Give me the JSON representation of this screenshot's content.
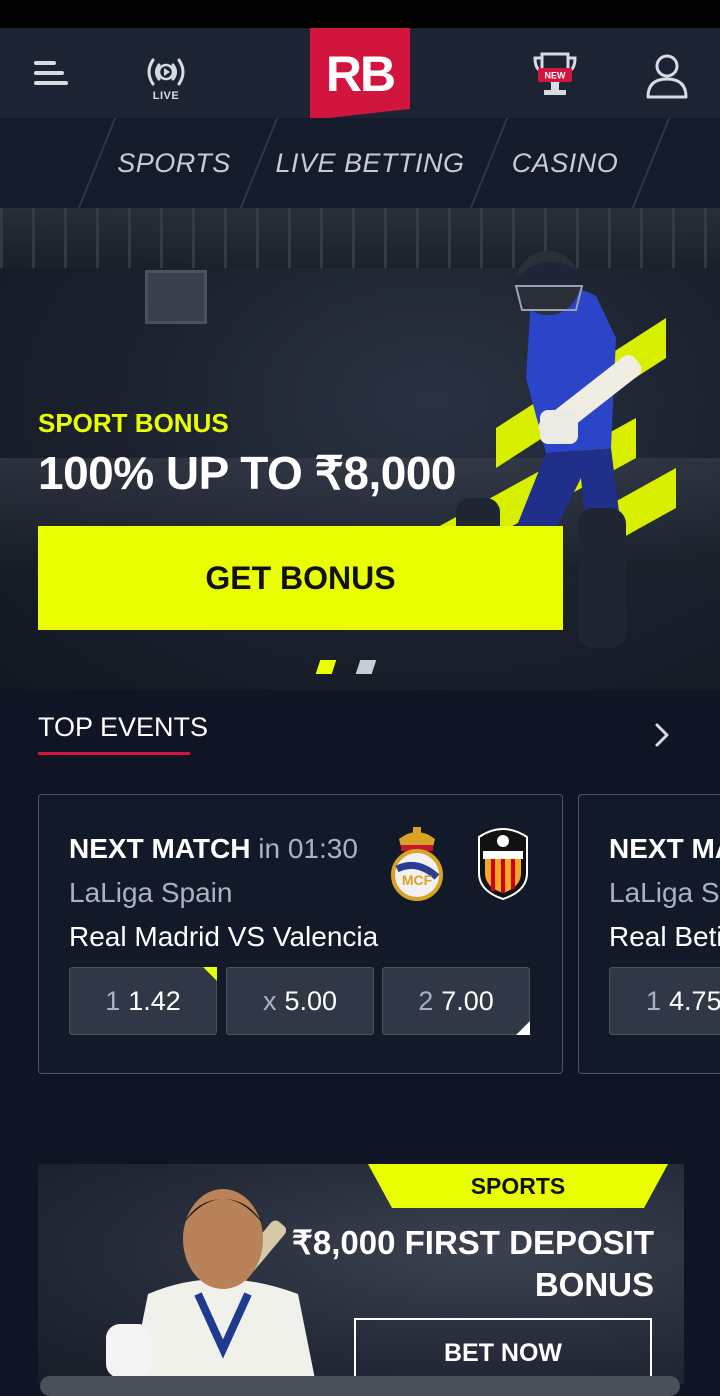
{
  "header": {
    "live_label": "LIVE",
    "logo_text": "RB",
    "new_badge": "NEW"
  },
  "nav": {
    "tabs": [
      {
        "label": "SPORTS"
      },
      {
        "label": "LIVE BETTING"
      },
      {
        "label": "CASINO"
      }
    ]
  },
  "hero": {
    "tag": "SPORT BONUS",
    "title": "100% UP TO ₹8,000",
    "cta": "GET BONUS",
    "slides": 2,
    "active_slide": 1
  },
  "top_events": {
    "title": "TOP EVENTS",
    "cards": [
      {
        "label": "NEXT MATCH",
        "time": "in 01:30",
        "league": "LaLiga Spain",
        "teams": "Real Madrid VS Valencia",
        "odds": [
          {
            "key": "1",
            "value": "1.42"
          },
          {
            "key": "x",
            "value": "5.00"
          },
          {
            "key": "2",
            "value": "7.00"
          }
        ]
      },
      {
        "label": "NEXT MA",
        "league": "LaLiga Sp",
        "teams": "Real Betis",
        "odds": [
          {
            "key": "1",
            "value": "4.75"
          }
        ]
      }
    ]
  },
  "promo": {
    "tag": "SPORTS",
    "headline_line1": "₹8,000 FIRST DEPOSIT",
    "headline_line2": "BONUS",
    "cta": "BET NOW"
  },
  "colors": {
    "accent_yellow": "#e9ff00",
    "brand_red": "#d2153c",
    "background": "#0f1524"
  }
}
